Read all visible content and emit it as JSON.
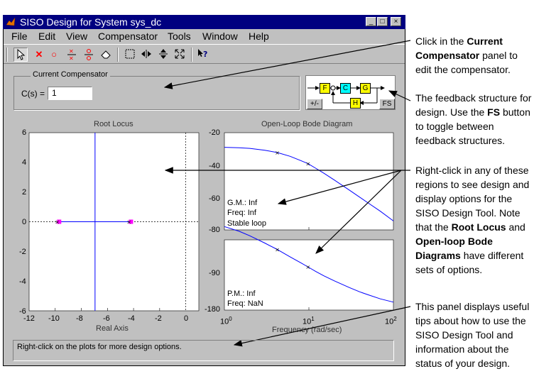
{
  "window": {
    "title": "SISO Design for System sys_dc",
    "minimize": "_",
    "maximize": "□",
    "close": "×"
  },
  "menu": [
    "File",
    "Edit",
    "View",
    "Compensator",
    "Tools",
    "Window",
    "Help"
  ],
  "toolbar": {
    "tools": [
      "select-arrow",
      "add-real-pole",
      "add-real-zero",
      "add-complex-pole",
      "add-complex-zero",
      "erase",
      "zoom-xy",
      "zoom-x",
      "zoom-y",
      "zoom-out",
      "help"
    ]
  },
  "compensator": {
    "legend": "Current Compensator",
    "label": "C(s) =",
    "value": "1"
  },
  "feedback_structure": {
    "blocks": [
      "F",
      "C",
      "G",
      "H"
    ],
    "sign_button": "+/-",
    "fs_button": "FS",
    "colors": {
      "ref_block": "#ffff00",
      "comp_block": "#00ffff",
      "plant_block": "#ffff00",
      "sensor_block": "#ffff00"
    }
  },
  "root_locus": {
    "title": "Root Locus",
    "xlabel": "Real Axis",
    "xticks": [
      "-12",
      "-10",
      "-8",
      "-6",
      "-4",
      "-2",
      "0"
    ],
    "yticks": [
      "6",
      "4",
      "2",
      "0",
      "-2",
      "-4",
      "-6"
    ]
  },
  "bode": {
    "title": "Open-Loop Bode Diagram",
    "xlabel": "Frequency (rad/sec)",
    "mag_ticks": [
      "-20",
      "-40",
      "-60",
      "-80"
    ],
    "phase_ticks": [
      "-90",
      "-180"
    ],
    "freq_ticks": [
      "10",
      "10",
      "10"
    ],
    "freq_exponents": [
      "0",
      "1",
      "2"
    ],
    "gain_margin": "G.M.: Inf",
    "gm_freq": "Freq: Inf",
    "stability": "Stable loop",
    "phase_margin": "P.M.: Inf",
    "pm_freq": "Freq: NaN"
  },
  "status": {
    "text": "Right-click on the plots for more design options."
  },
  "colors": {
    "plot_line": "#0000ff",
    "pole_marker": "#ff00ff",
    "window_bg": "#c0c0c0",
    "title_bar": "#000080"
  },
  "chart_data": [
    {
      "type": "scatter",
      "title": "Root Locus",
      "xlabel": "Real Axis",
      "ylabel": "",
      "xlim": [
        -12,
        1
      ],
      "ylim": [
        -6,
        6
      ],
      "series": [
        {
          "name": "",
          "x": [
            -9.7,
            -4.2
          ],
          "y": [
            0,
            0
          ]
        }
      ],
      "grid": false
    },
    {
      "type": "line",
      "title": "Open-Loop Bode Diagram",
      "xlabel": "Frequency (rad/sec)",
      "ylabel": "",
      "xscale": "log",
      "xlim": [
        1,
        100
      ],
      "ylim": [
        -80,
        -20
      ],
      "series": [
        {
          "name": "",
          "x": [
            1,
            1.5,
            2,
            3,
            4.2,
            6,
            8,
            9.7,
            12,
            15,
            20,
            30,
            40,
            50,
            70,
            100
          ],
          "y": [
            -29.0,
            -29.3,
            -29.7,
            -30.8,
            -32.2,
            -34.6,
            -37.2,
            -39.0,
            -41.9,
            -45.0,
            -49.2,
            -55.4,
            -59.8,
            -63.3,
            -68.5,
            -74.5
          ]
        }
      ],
      "grid": false
    },
    {
      "type": "line",
      "title": "",
      "xlabel": "Frequency (rad/sec)",
      "ylabel": "",
      "xscale": "log",
      "xlim": [
        1,
        100
      ],
      "ylim": [
        -180,
        -45
      ],
      "series": [
        {
          "name": "",
          "x": [
            1,
            1.5,
            2,
            3,
            4.2,
            6,
            8,
            9.7,
            12,
            15,
            20,
            30,
            40,
            50,
            70,
            100
          ],
          "y": [
            -19.5,
            -28.6,
            -37.2,
            -51.2,
            -63.4,
            -77.9,
            -89.1,
            -96.8,
            -105.6,
            -114.2,
            -123.8,
            -136.7,
            -145.0,
            -150.5,
            -158.5,
            -164.7
          ]
        }
      ],
      "grid": false
    }
  ],
  "callouts": {
    "c1": [
      "Click in the ",
      "Current Compensator",
      " panel to edit the compensator."
    ],
    "c2": [
      "The feedback structure for design. Use the ",
      "FS",
      " button to toggle between feedback structures."
    ],
    "c3": [
      "Right-click in any of these regions to see design and display options for the SISO Design Tool. Note that the ",
      "Root Locus",
      " and ",
      "Open-loop Bode Diagrams",
      " have different sets of options."
    ],
    "c4": [
      "This panel displays useful tips about how to use the SISO Design Tool and information about the status of your design."
    ]
  }
}
